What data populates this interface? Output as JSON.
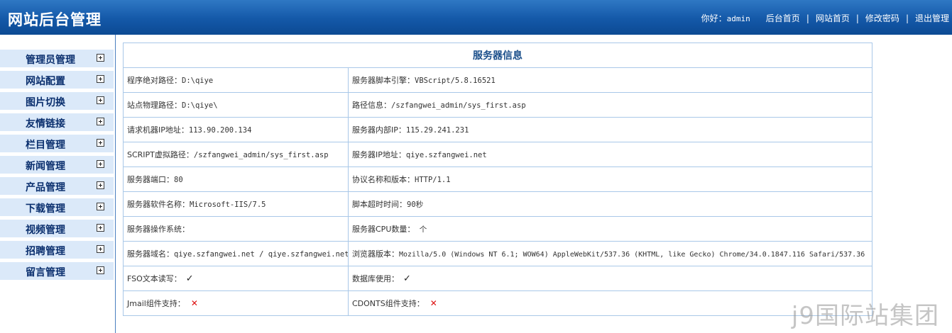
{
  "header": {
    "title": "网站后台管理",
    "greeting": "你好：",
    "username": "admin",
    "links": [
      "后台首页",
      "网站首页",
      "修改密码",
      "退出管理"
    ],
    "separator": "|"
  },
  "sidebar": {
    "items": [
      "管理员管理",
      "网站配置",
      "图片切换",
      "友情链接",
      "栏目管理",
      "新闻管理",
      "产品管理",
      "下载管理",
      "视频管理",
      "招聘管理",
      "留言管理"
    ],
    "icon": "expand-plus-icon"
  },
  "server_info": {
    "title": "服务器信息",
    "rows": [
      [
        {
          "label": "程序绝对路径：",
          "value": "D:\\qiye"
        },
        {
          "label": "服务器脚本引擎：",
          "value": "VBScript/5.8.16521"
        }
      ],
      [
        {
          "label": "站点物理路径：",
          "value": "D:\\qiye\\"
        },
        {
          "label": "路径信息：",
          "value": "/szfangwei_admin/sys_first.asp"
        }
      ],
      [
        {
          "label": "请求机器IP地址：",
          "value": "113.90.200.134"
        },
        {
          "label": "服务器内部IP：",
          "value": "115.29.241.231"
        }
      ],
      [
        {
          "label": "SCRIPT虚拟路径：",
          "value": "/szfangwei_admin/sys_first.asp"
        },
        {
          "label": "服务器IP地址：",
          "value": "qiye.szfangwei.net"
        }
      ],
      [
        {
          "label": "服务器端口：",
          "value": "80"
        },
        {
          "label": "协议名称和版本：",
          "value": "HTTP/1.1"
        }
      ],
      [
        {
          "label": "服务器软件名称：",
          "value": "Microsoft-IIS/7.5"
        },
        {
          "label": "脚本超时时间：",
          "value": "90秒"
        }
      ],
      [
        {
          "label": "服务器操作系统：",
          "value": ""
        },
        {
          "label": "服务器CPU数量：",
          "value": " 个"
        }
      ],
      [
        {
          "label": "服务器域名：",
          "value": "qiye.szfangwei.net / qiye.szfangwei.net"
        },
        {
          "label": "浏览器版本：",
          "value": "Mozilla/5.0 (Windows NT 6.1; WOW64) AppleWebKit/537.36 (KHTML, like Gecko) Chrome/34.0.1847.116 Safari/537.36"
        }
      ]
    ],
    "support_rows": [
      [
        {
          "label": "FSO文本读写：",
          "mark": "✓",
          "status": "supported"
        },
        {
          "label": "数据库使用：",
          "mark": "✓",
          "status": "supported"
        }
      ],
      [
        {
          "label": "Jmail组件支持：",
          "mark": "✕",
          "status": "unsupported"
        },
        {
          "label": "CDONTS组件支持：",
          "mark": "✕",
          "status": "unsupported"
        }
      ]
    ]
  },
  "watermark": "j9国际站集团",
  "colors": {
    "header_top": "#2f78c4",
    "header_bottom": "#0c4a93",
    "sidebar_item_bg": "#dbe9f9",
    "sidebar_text": "#0a2f6e",
    "table_border": "#a9c8e8",
    "title_text": "#1a4e8a",
    "error_mark": "#dd1111"
  }
}
